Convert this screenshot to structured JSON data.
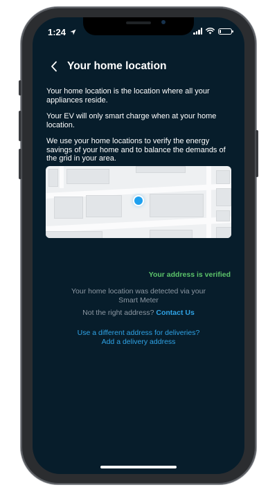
{
  "status_bar": {
    "time": "1:24",
    "icons": [
      "location-arrow-icon",
      "cellular-signal-icon",
      "wifi-icon",
      "battery-icon"
    ]
  },
  "header": {
    "back_icon": "chevron-left-icon",
    "title": "Your home location"
  },
  "intro": {
    "p1": "Your home location is the location where all your appliances reside.",
    "p2": "Your EV will only smart charge when at your home location.",
    "p3": "We use your home locations to verify the energy savings of your home and to balance the demands of the grid in your area."
  },
  "map": {
    "marker_icon": "location-dot-icon"
  },
  "verification": {
    "status": "Your address is verified",
    "detected_line1": "Your home location was detected via your",
    "detected_line2": "Smart Meter",
    "wrong_prompt": "Not the right address?",
    "contact_link": "Contact Us",
    "delivery_question": "Use a different address for deliveries?",
    "delivery_link": "Add a delivery address"
  },
  "colors": {
    "background": "#071d2b",
    "verified_green": "#5cc46a",
    "link_blue": "#2fa3e6",
    "muted_gray": "#8d98a3"
  }
}
